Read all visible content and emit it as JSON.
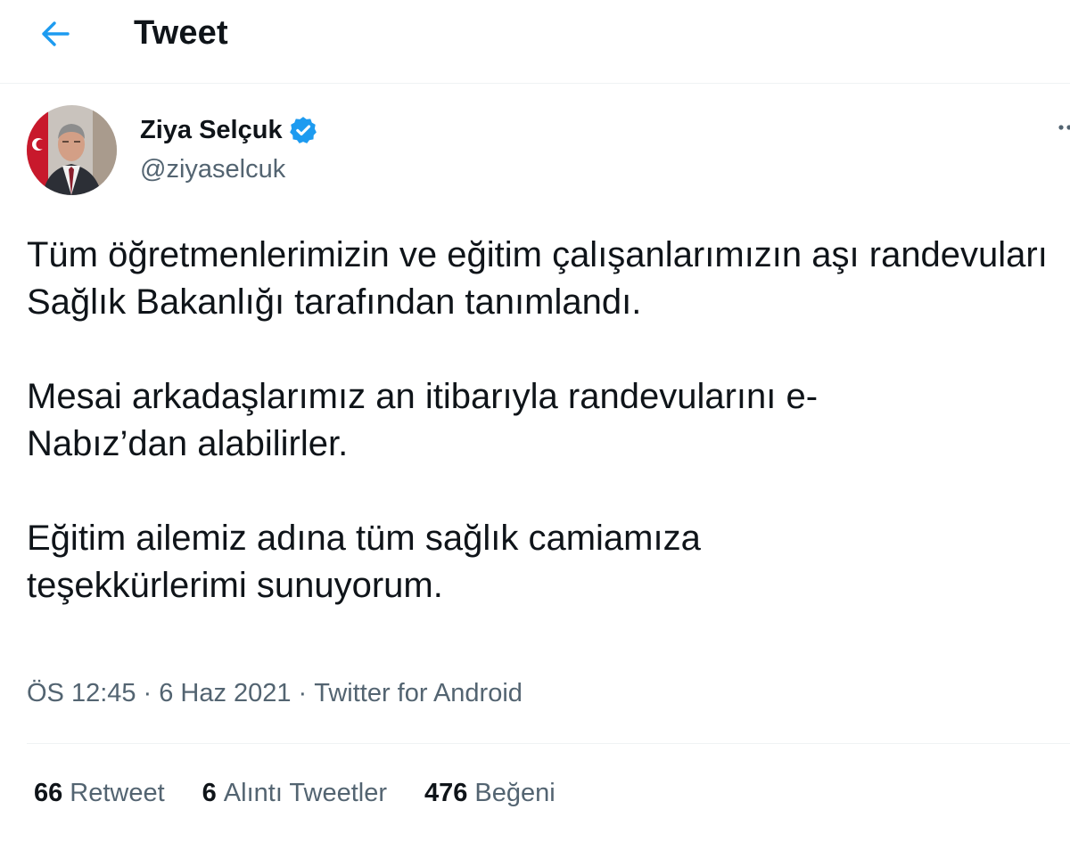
{
  "header": {
    "title": "Tweet",
    "back_icon": "arrow-left-icon",
    "accent_color": "#1d9bf0"
  },
  "author": {
    "name": "Ziya Selçuk",
    "handle": "@ziyaselcuk",
    "verified_icon": "verified-badge-icon",
    "avatar_icon": "avatar"
  },
  "more_icon": "more-options-icon",
  "tweet": {
    "paragraphs": [
      "Tüm öğretmenlerimizin ve eğitim çalışanlarımızın aşı randevuları Sağlık Bakanlığı tarafından tanımlandı.",
      "Mesai arkadaşlarımız an itibarıyla randevularını e-Nabız’dan alabilirler.",
      "Eğitim ailemiz adına tüm sağlık camiamıza teşekkürlerimi sunuyorum."
    ]
  },
  "meta": {
    "time": "ÖS 12:45",
    "separator": "·",
    "date": "6 Haz 2021",
    "source": "Twitter for Android"
  },
  "stats": {
    "retweets_count": "66",
    "retweets_label": "Retweet",
    "quotes_count": "6",
    "quotes_label": "Alıntı Tweetler",
    "likes_count": "476",
    "likes_label": "Beğeni"
  }
}
